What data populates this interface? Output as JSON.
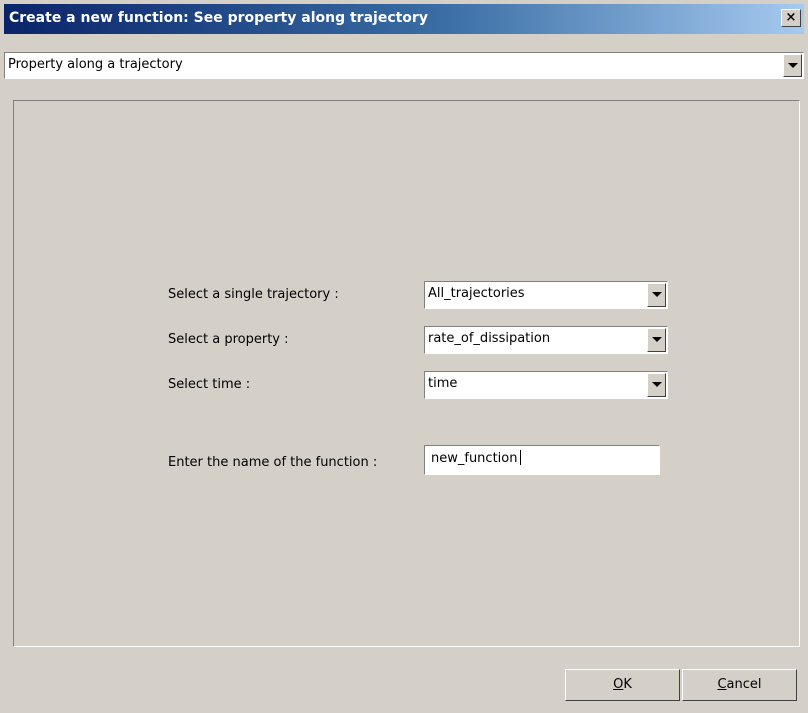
{
  "window": {
    "title": "Create a new function: See property along trajectory",
    "close_label": "×"
  },
  "function_type": {
    "selected": "Property along a trajectory"
  },
  "form": {
    "trajectory_label": "Select a single trajectory :",
    "trajectory_value": "All_trajectories",
    "property_label": "Select a property :",
    "property_value": "rate_of_dissipation",
    "time_label": "Select time :",
    "time_value": "time",
    "name_label": "Enter the name of the function :",
    "name_value": "new_function"
  },
  "buttons": {
    "ok_mnemonic": "O",
    "ok_rest": "K",
    "cancel_mnemonic": "C",
    "cancel_rest": "ancel"
  }
}
